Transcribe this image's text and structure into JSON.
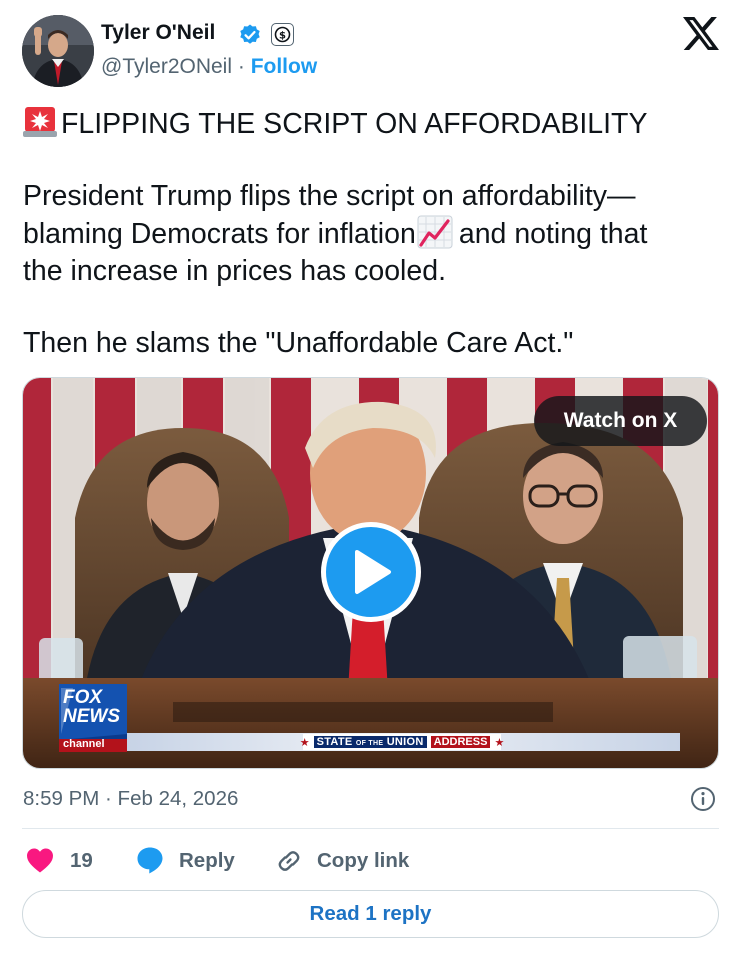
{
  "author": {
    "display_name": "Tyler O'Neil",
    "handle": "@Tyler2ONeil",
    "separator": " · ",
    "follow_label": "Follow",
    "verified": true,
    "verified_color": "#1d9bf0",
    "subscription_badge_icon": "dollar-badge-icon"
  },
  "platform_logo_icon": "x-logo-icon",
  "tweet": {
    "headline": "FLIPPING THE SCRIPT ON AFFORDABILITY",
    "paragraph1_line1": "President Trump flips the script on affordability—",
    "paragraph1_line2a": "blaming Democrats for inflation",
    "paragraph1_line2b": "and noting that",
    "paragraph1_line3": "the increase in prices has cooled.",
    "paragraph2": "Then he slams the \"Unaffordable Care Act.\"",
    "emojis": [
      "rotating-light-emoji",
      "chart-increasing-emoji"
    ]
  },
  "media": {
    "watch_label": "Watch on X",
    "play_icon": "play-icon",
    "network_logo": {
      "line1": "FOX",
      "line2": "NEWS",
      "line3": "channel"
    },
    "banner": {
      "prefix_star": "★",
      "main": "STATE",
      "of": "OF THE",
      "union": "UNION",
      "address": "ADDRESS",
      "suffix_star": "★"
    }
  },
  "footer": {
    "timestamp": "8:59 PM · Feb 24, 2026",
    "like_count": "19",
    "reply_label": "Reply",
    "copy_link_label": "Copy link",
    "read_replies_label": "Read 1 reply"
  },
  "colors": {
    "accent": "#1d9bf0",
    "heart": "#f91880",
    "secondary_text": "#536471",
    "primary_text": "#0f1419"
  }
}
